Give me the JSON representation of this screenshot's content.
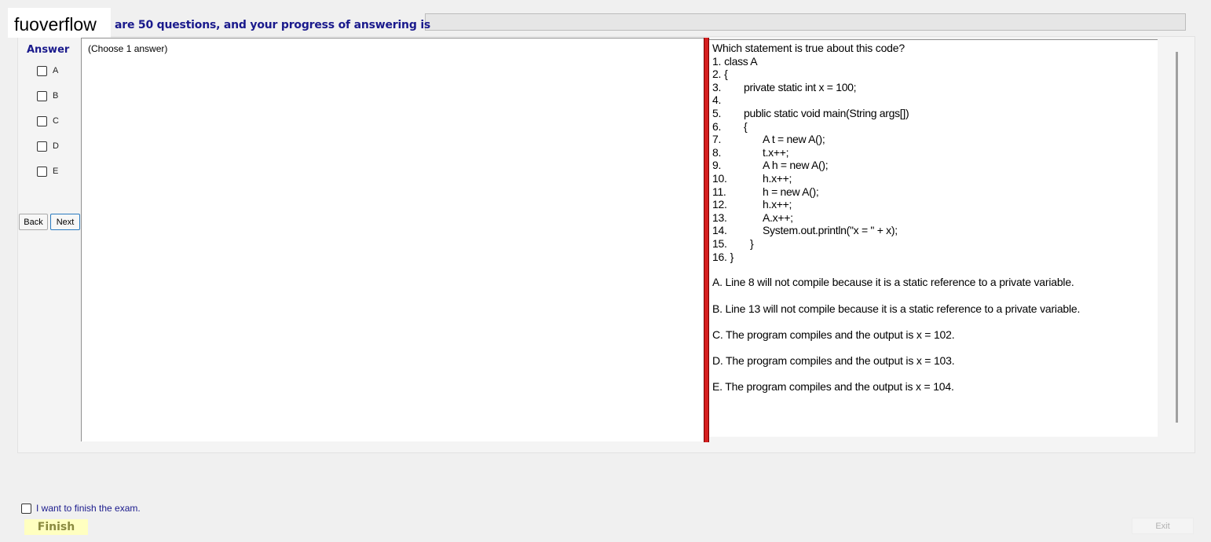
{
  "logo": "fuoverflow",
  "header": {
    "progress_text": "are 50 questions, and your progress of answering is"
  },
  "answer": {
    "title": "Answer",
    "options": [
      "A",
      "B",
      "C",
      "D",
      "E"
    ]
  },
  "nav": {
    "back": "Back",
    "next": "Next"
  },
  "left_pane": {
    "hint": "(Choose 1 answer)"
  },
  "question": {
    "prompt": "Which statement is true about this code?",
    "code": [
      {
        "num": "1.",
        "text": "class A"
      },
      {
        "num": "2.",
        "text": "{"
      },
      {
        "num": "3.",
        "text": "private static int x = 100;"
      },
      {
        "num": "4.",
        "text": ""
      },
      {
        "num": "5.",
        "text": "public static void main(String args[])"
      },
      {
        "num": "6.",
        "text": "{"
      },
      {
        "num": "7.",
        "text": "A t = new A();"
      },
      {
        "num": "8.",
        "text": "t.x++;"
      },
      {
        "num": "9.",
        "text": "A h = new A();"
      },
      {
        "num": "10.",
        "text": "h.x++;"
      },
      {
        "num": "11.",
        "text": "h = new A();"
      },
      {
        "num": "12.",
        "text": "h.x++;"
      },
      {
        "num": "13.",
        "text": "A.x++;"
      },
      {
        "num": "14.",
        "text": "System.out.println(\"x = \" + x);"
      },
      {
        "num": "15.",
        "text": "}"
      },
      {
        "num": "16.",
        "text": "}"
      }
    ],
    "choices": [
      "A.  Line 8 will not compile because it is a static reference to a private variable.",
      "B.  Line 13 will not compile because it is a static reference to a private variable.",
      "C.  The program compiles and the output is x = 102.",
      "D.  The program compiles and the output is x = 103.",
      "E.  The program compiles and the output is x = 104."
    ]
  },
  "footer": {
    "finish_check_label": "I want to finish the exam.",
    "finish": "Finish",
    "exit": "Exit"
  }
}
